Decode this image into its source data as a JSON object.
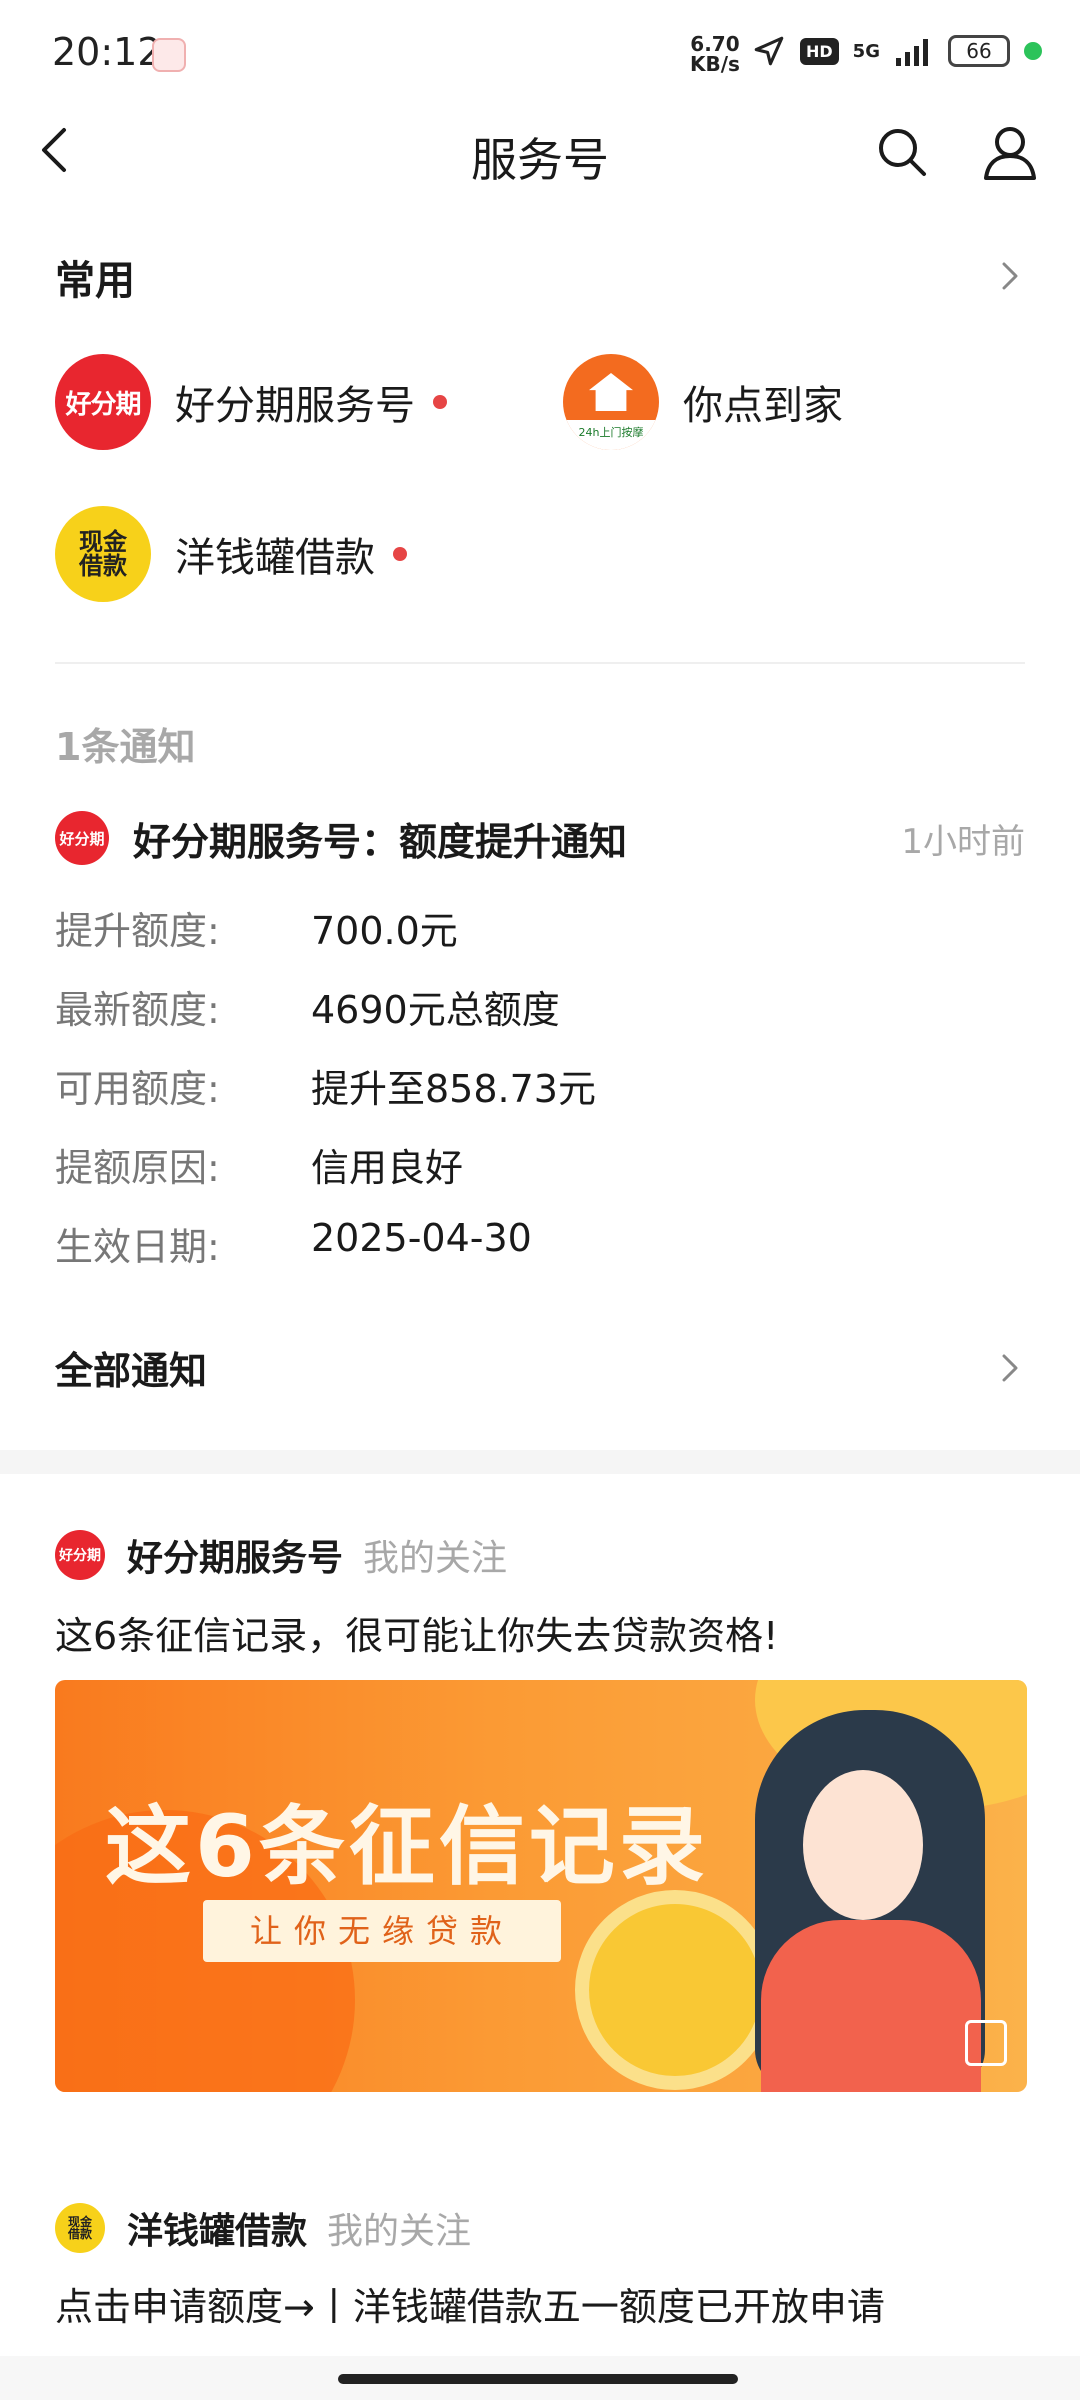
{
  "status_bar": {
    "time": "20:12",
    "net_speed_value": "6.70",
    "net_speed_unit": "KB/s",
    "hd": "HD",
    "network": "5G",
    "battery": "66"
  },
  "header": {
    "title": "服务号"
  },
  "common": {
    "label": "常用",
    "accounts": [
      {
        "name": "好分期服务号",
        "unread": true,
        "logo_text": "好分期"
      },
      {
        "name": "你点到家",
        "unread": false,
        "logo_text": "24h上门按摩"
      },
      {
        "name": "洋钱罐借款",
        "unread": true,
        "logo_text": "现金借款"
      }
    ]
  },
  "notice": {
    "count_label": "1条通知",
    "logo_text": "好分期",
    "title": "好分期服务号：额度提升通知",
    "time": "1小时前",
    "fields": [
      {
        "key": "提升额度:",
        "value": "700.0元"
      },
      {
        "key": "最新额度:",
        "value": "4690元总额度"
      },
      {
        "key": "可用额度:",
        "value": "提升至858.73元"
      },
      {
        "key": "提额原因:",
        "value": "信用良好"
      },
      {
        "key": "生效日期:",
        "value": "2025-04-30"
      }
    ],
    "all_label": "全部通知"
  },
  "feed": [
    {
      "account": "好分期服务号",
      "follow": "我的关注",
      "logo_text": "好分期",
      "title": "这6条征信记录，很可能让你失去贷款资格!",
      "banner_headline": "这6条征信记录",
      "banner_sub": "让你无缘贷款"
    },
    {
      "account": "洋钱罐借款",
      "follow": "我的关注",
      "logo_text": "现金借款",
      "title": "点击申请额度→丨洋钱罐借款五一额度已开放申请"
    }
  ],
  "colors": {
    "accent_red": "#e8262f",
    "unread_dot": "#e64545",
    "muted_text": "#a8a8a8",
    "banner_orange": "#f97a1e"
  }
}
